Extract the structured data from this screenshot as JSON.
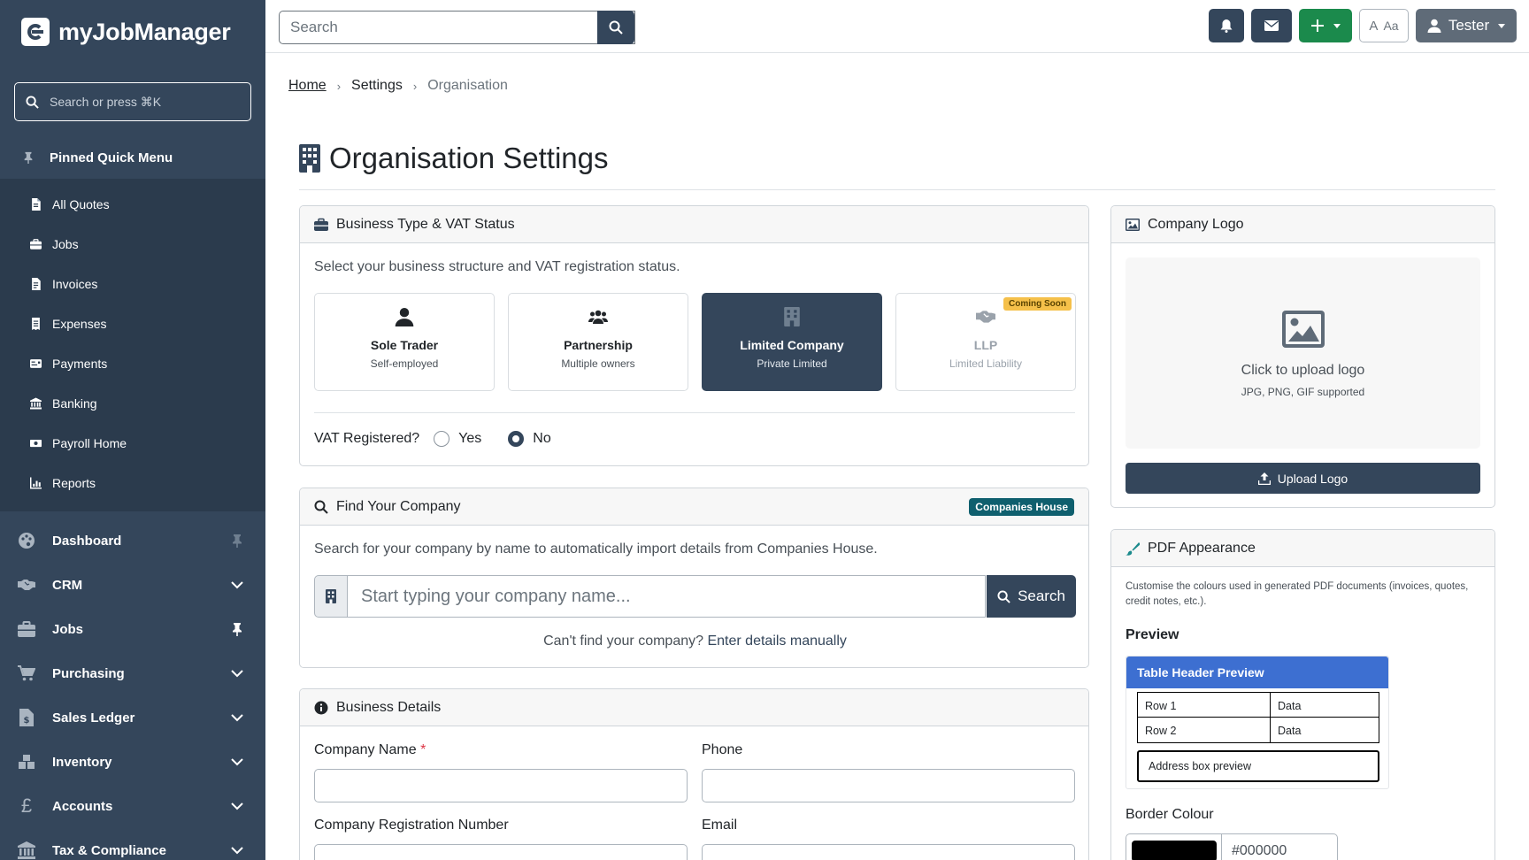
{
  "brand": {
    "name": "myJobManager"
  },
  "sidebar": {
    "search_placeholder": "Search or press ⌘K",
    "pinned_title": "Pinned Quick Menu",
    "pinned_items": [
      "All Quotes",
      "Jobs",
      "Invoices",
      "Expenses",
      "Payments",
      "Banking",
      "Payroll Home",
      "Reports"
    ],
    "nav": [
      "Dashboard",
      "CRM",
      "Jobs",
      "Purchasing",
      "Sales Ledger",
      "Inventory",
      "Accounts",
      "Tax & Compliance"
    ]
  },
  "topbar": {
    "search_placeholder": "Search",
    "font_label_a": "A",
    "font_label_aa": "Aa",
    "user": "Tester"
  },
  "breadcrumb": {
    "home": "Home",
    "settings": "Settings",
    "current": "Organisation"
  },
  "page": {
    "title": "Organisation Settings"
  },
  "business_type": {
    "title": "Business Type & VAT Status",
    "description": "Select your business structure and VAT registration status.",
    "options": [
      {
        "title": "Sole Trader",
        "sub": "Self-employed"
      },
      {
        "title": "Partnership",
        "sub": "Multiple owners"
      },
      {
        "title": "Limited Company",
        "sub": "Private Limited"
      },
      {
        "title": "LLP",
        "sub": "Limited Liability",
        "badge": "Coming Soon"
      }
    ],
    "vat_label": "VAT Registered?",
    "vat_yes": "Yes",
    "vat_no": "No"
  },
  "find_company": {
    "title": "Find Your Company",
    "badge": "Companies House",
    "description": "Search for your company by name to automatically import details from Companies House.",
    "placeholder": "Start typing your company name...",
    "search_button": "Search",
    "manual_prefix": "Can't find your company?",
    "manual_link": "Enter details manually"
  },
  "business_details": {
    "title": "Business Details",
    "company_name": "Company Name",
    "required_mark": "*",
    "phone": "Phone",
    "reg_number": "Company Registration Number",
    "email": "Email"
  },
  "logo": {
    "title": "Company Logo",
    "upload_text": "Click to upload logo",
    "formats": "JPG, PNG, GIF supported",
    "upload_button": "Upload Logo"
  },
  "pdf": {
    "title": "PDF Appearance",
    "description": "Customise the colours used in generated PDF documents (invoices, quotes, credit notes, etc.).",
    "preview_label": "Preview",
    "table_header": "Table Header Preview",
    "rows": [
      [
        "Row 1",
        "Data"
      ],
      [
        "Row 2",
        "Data"
      ]
    ],
    "address_box": "Address box preview",
    "border_label": "Border Colour",
    "border_value": "#000000",
    "header_color": "#3d6fd1"
  }
}
